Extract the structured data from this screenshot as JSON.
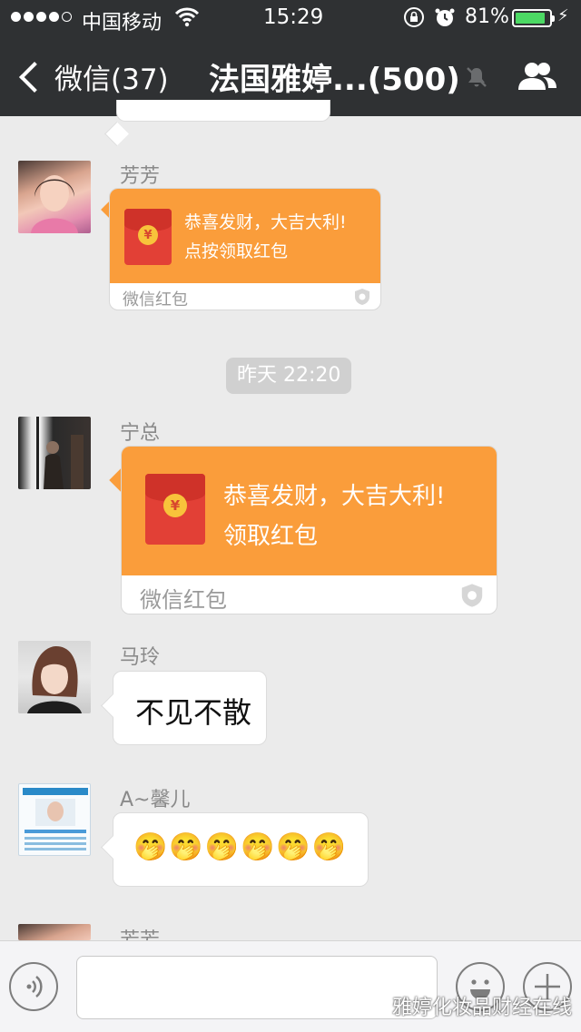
{
  "status_bar": {
    "carrier": "中国移动",
    "time": "15:29",
    "battery_percent": "81%",
    "battery_level": 0.81,
    "signal_bars": 4
  },
  "nav": {
    "back_label": "微信(37)",
    "title": "法国雅婷...(500)"
  },
  "messages": [
    {
      "sender": "芳芳",
      "type": "red_packet",
      "greeting": "恭喜发财，大吉大利!",
      "action": "点按领取红包",
      "footer": "微信红包"
    },
    {
      "sender": "宁总",
      "type": "red_packet",
      "greeting": "恭喜发财，大吉大利!",
      "action": "领取红包",
      "footer": "微信红包"
    },
    {
      "sender": "马玲",
      "type": "text",
      "text": "不见不散"
    },
    {
      "sender": "A~馨儿",
      "type": "emoji",
      "text": "🤭🤭🤭🤭🤭🤭"
    },
    {
      "sender": "芳芳",
      "type": "partial"
    }
  ],
  "timestamp": "昨天 22:20",
  "input": {
    "value": "",
    "placeholder": ""
  },
  "watermark": "雅婷化妆品财经在线",
  "icons": {
    "voice": "voice-icon",
    "emoji": "emoji-icon",
    "plus": "plus-icon",
    "mute": "mute-icon",
    "group": "group-icon",
    "coin": "yuan-coin-icon"
  },
  "colors": {
    "nav_bg": "#2f3133",
    "red_packet_orange": "#fa9d3b",
    "chat_bg": "#ebebeb",
    "battery_green": "#4cd964"
  }
}
